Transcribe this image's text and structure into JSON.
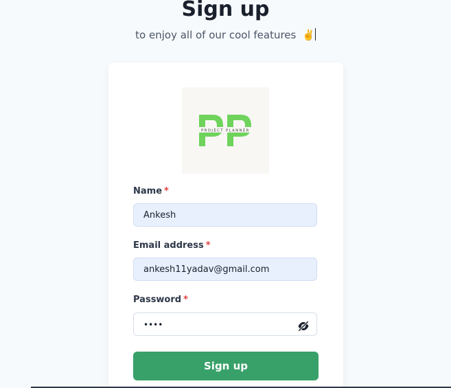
{
  "header": {
    "title": "Sign up",
    "subtitle": "to enjoy all of our cool features",
    "emoji": "✌️"
  },
  "logo": {
    "letters": "PP",
    "tagline": "PROJECT PLANNER",
    "accent_color": "#6fd35c"
  },
  "form": {
    "name": {
      "label": "Name",
      "required_mark": "*",
      "value": "Ankesh"
    },
    "email": {
      "label": "Email address",
      "required_mark": "*",
      "value": "ankesh11yadav@gmail.com"
    },
    "password": {
      "label": "Password",
      "required_mark": "*",
      "value": "••••",
      "toggle_icon": "eye-slash-icon"
    },
    "submit_label": "Sign up"
  },
  "colors": {
    "primary": "#38a169",
    "required": "#e53e3e",
    "autofill_bg": "#e8f0fe"
  }
}
